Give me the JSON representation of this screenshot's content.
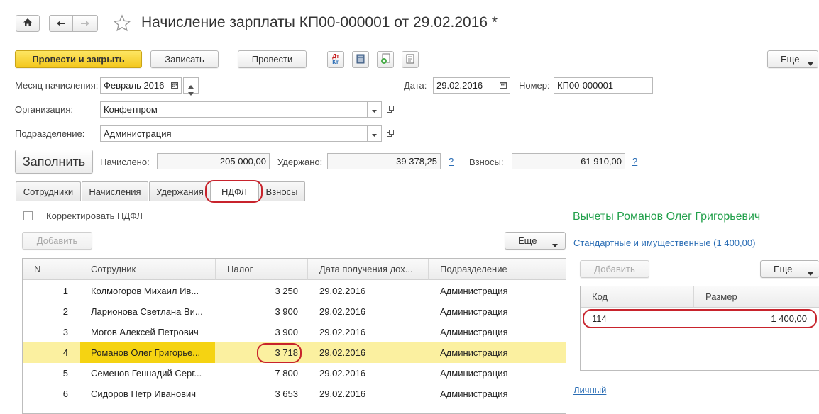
{
  "header": {
    "title": "Начисление зарплаты КП00-000001 от 29.02.2016 *"
  },
  "toolbar": {
    "post_close": "Провести и закрыть",
    "save": "Записать",
    "post": "Провести",
    "more": "Еще"
  },
  "form": {
    "month_label": "Месяц начисления:",
    "month_value": "Февраль 2016",
    "date_label": "Дата:",
    "date_value": "29.02.2016",
    "number_label": "Номер:",
    "number_value": "КП00-000001",
    "org_label": "Организация:",
    "org_value": "Конфетпром",
    "dept_label": "Подразделение:",
    "dept_value": "Администрация",
    "fill_button": "Заполнить",
    "accrued_label": "Начислено:",
    "accrued_value": "205 000,00",
    "withheld_label": "Удержано:",
    "withheld_value": "39 378,25",
    "contrib_label": "Взносы:",
    "contrib_value": "61 910,00",
    "help": "?"
  },
  "tabs": [
    {
      "label": "Сотрудники"
    },
    {
      "label": "Начисления"
    },
    {
      "label": "Удержания"
    },
    {
      "label": "НДФЛ"
    },
    {
      "label": "Взносы"
    }
  ],
  "ndfl": {
    "correct_label": "Корректировать НДФЛ",
    "add_button": "Добавить",
    "more_button": "Еще",
    "columns": [
      "N",
      "Сотрудник",
      "Налог",
      "Дата получения дох...",
      "Подразделение"
    ],
    "rows": [
      {
        "n": "1",
        "employee": "Колмогоров Михаил Ив...",
        "tax": "3 250",
        "date": "29.02.2016",
        "dept": "Администрация"
      },
      {
        "n": "2",
        "employee": "Ларионова Светлана Ви...",
        "tax": "3 900",
        "date": "29.02.2016",
        "dept": "Администрация"
      },
      {
        "n": "3",
        "employee": "Могов Алексей Петрович",
        "tax": "3 900",
        "date": "29.02.2016",
        "dept": "Администрация"
      },
      {
        "n": "4",
        "employee": "Романов Олег Григорье...",
        "tax": "3 718",
        "date": "29.02.2016",
        "dept": "Администрация"
      },
      {
        "n": "5",
        "employee": "Семенов Геннадий Серг...",
        "tax": "7 800",
        "date": "29.02.2016",
        "dept": "Администрация"
      },
      {
        "n": "6",
        "employee": "Сидоров Петр Иванович",
        "tax": "3 653",
        "date": "29.02.2016",
        "dept": "Администрация"
      }
    ]
  },
  "deductions": {
    "title": "Вычеты Романов Олег Григорьевич",
    "standard_link": "Стандартные и имущественные (1 400,00)",
    "add_button": "Добавить",
    "more_button": "Еще",
    "columns": [
      "Код",
      "Размер"
    ],
    "rows": [
      {
        "code": "114",
        "amount": "1 400,00"
      }
    ],
    "personal_link": "Личный"
  },
  "colors": {
    "accent_yellow": "#f3c71c",
    "selected_row": "#fbf0a0",
    "selected_cell": "#f5d312",
    "highlight_red": "#c8232c",
    "link_blue": "#2a6db5",
    "title_green": "#22a04b"
  },
  "icons": [
    "home-icon",
    "arrow-left-icon",
    "arrow-right-icon",
    "star-icon",
    "dt-kt-icon",
    "register-icon",
    "report-icon",
    "doc-icon",
    "calendar-icon",
    "chevron-down-icon",
    "open-icon",
    "spin-up-icon",
    "spin-down-icon"
  ]
}
